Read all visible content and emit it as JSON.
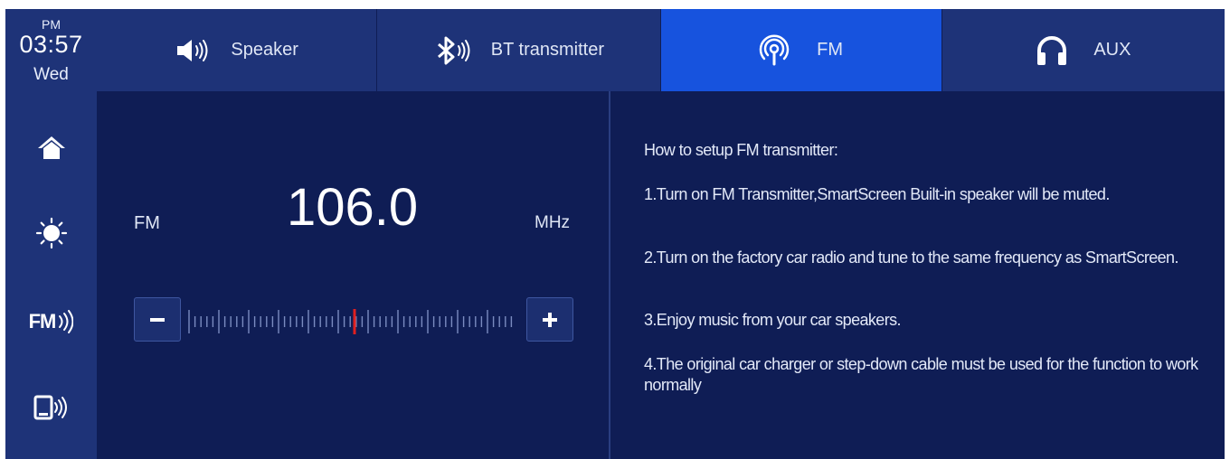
{
  "status": {
    "ampm": "PM",
    "time": "03:57",
    "day": "Wed"
  },
  "tabs": [
    {
      "label": "Speaker",
      "icon": "speaker-icon",
      "active": false
    },
    {
      "label": "BT transmitter",
      "icon": "bluetooth-icon",
      "active": false
    },
    {
      "label": "FM",
      "icon": "antenna-icon",
      "active": true
    },
    {
      "label": "AUX",
      "icon": "headphones-icon",
      "active": false
    }
  ],
  "sidebar": {
    "items": [
      {
        "icon": "home-icon"
      },
      {
        "icon": "brightness-icon"
      },
      {
        "icon": "fm-transmitter-icon",
        "text": "FM"
      },
      {
        "icon": "phone-cast-icon"
      }
    ]
  },
  "tuner": {
    "band_label": "FM",
    "frequency": "106.0",
    "unit": "MHz",
    "minus_icon": "minus-icon",
    "plus_icon": "plus-icon"
  },
  "instructions": {
    "title": "How to setup FM transmitter:",
    "steps": [
      "1.Turn on FM Transmitter,SmartScreen Built-in speaker will be muted.",
      "2.Turn on the factory car radio and tune to the same frequency as SmartScreen.",
      "3.Enjoy music from your car speakers.",
      "4.The original car charger or step-down cable must be used for the function to work normally"
    ]
  },
  "colors": {
    "background": "#0f1d55",
    "sidebar": "#1e3378",
    "active_tab": "#1753de",
    "tuner_marker": "#e02020"
  }
}
